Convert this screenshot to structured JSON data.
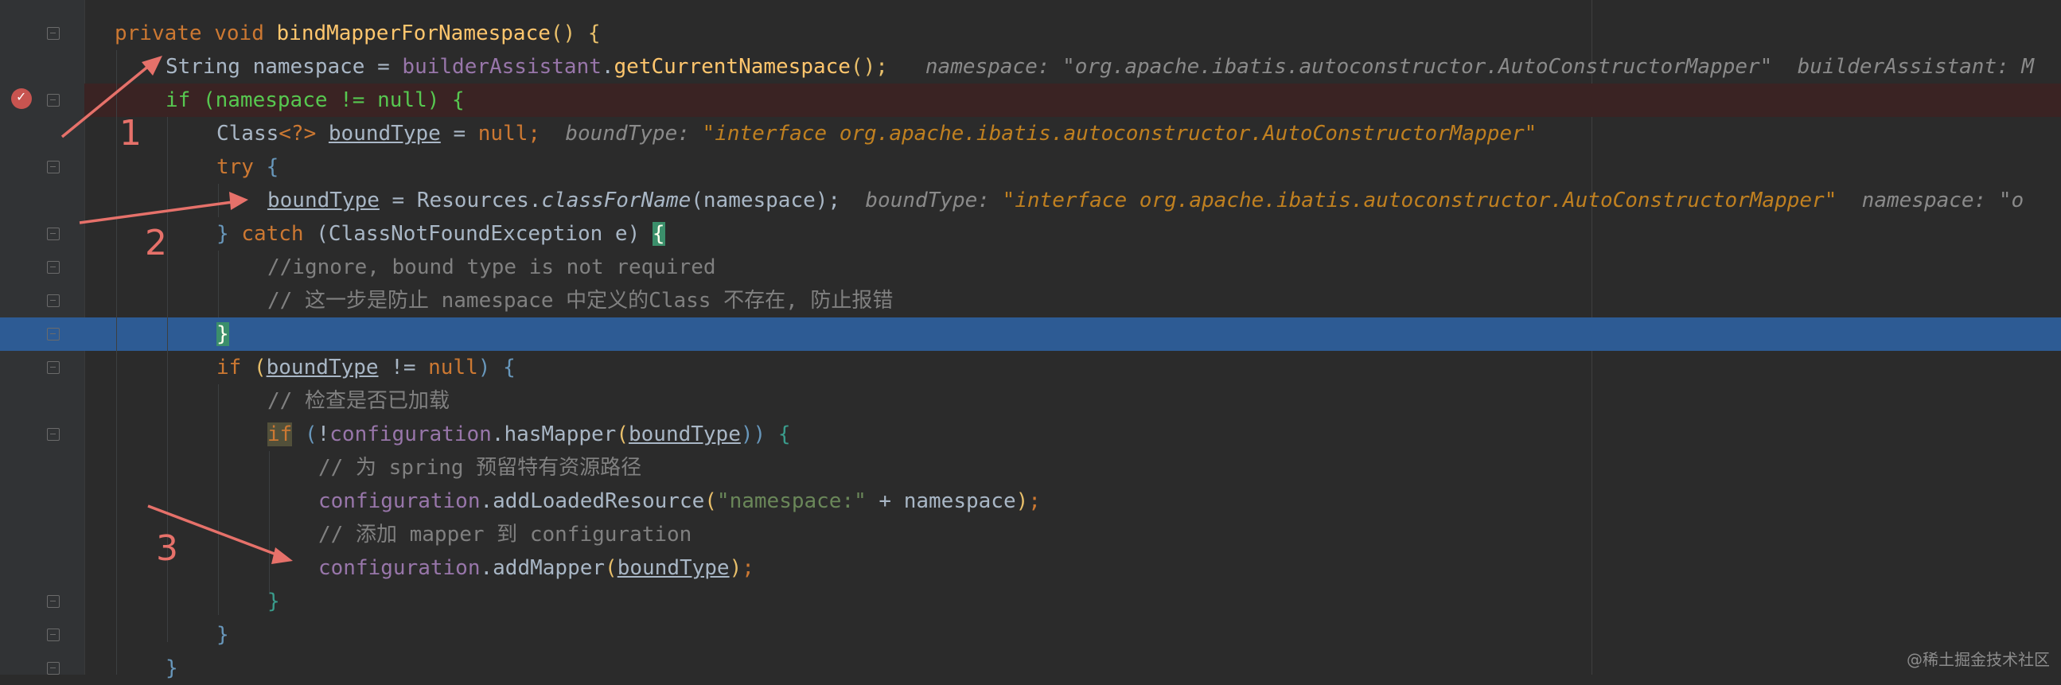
{
  "code": {
    "l1": {
      "a": "private ",
      "b": "void ",
      "c": "bindMapperForNamespace",
      "d": "() {"
    },
    "l2": {
      "a": "String namespace = ",
      "b": "builderAssistant",
      ".": ".",
      "c": "getCurrentNamespace",
      "d": "();",
      "h1": "namespace: ",
      "v1": "\"org.apache.ibatis.autoconstructor.AutoConstructorMapper\"",
      "h2": "builderAssistant: M"
    },
    "l3": {
      "a": "if ",
      "b": "(namespace != null) {"
    },
    "l4": {
      "a": "Class",
      "b": "<?>",
      "c": " ",
      "d": "boundType",
      "e": " = ",
      "f": "null",
      ";": ";",
      "h": "boundType: ",
      "v": "\"interface org.apache.ibatis.autoconstructor.AutoConstructorMapper\""
    },
    "l5": {
      "a": "try ",
      "b": "{"
    },
    "l6": {
      "a": "boundType",
      "b": " = Resources.",
      "c": "classForName",
      "d": "(namespace);",
      "h1": "boundType: ",
      "v1": "\"interface org.apache.ibatis.autoconstructor.AutoConstructorMapper\"",
      "h2": "namespace: \"o"
    },
    "l7": {
      "a": "} ",
      "b": "catch ",
      "c": "(ClassNotFoundException e) ",
      "d": "{"
    },
    "l8": "//ignore, bound type is not required",
    "l9": "// 这一步是防止 namespace 中定义的Class 不存在, 防止报错",
    "l10": "}",
    "l11": {
      "a": "if ",
      "b": "(",
      "c": "boundType",
      "d": " != ",
      "e": "null",
      "f": ") {"
    },
    "l12": "// 检查是否已加载",
    "l13": {
      "a": "if",
      "b": " (",
      "c": "!",
      "d": "configuration",
      ".": ".",
      "e": "hasMapper",
      "f": "(",
      "g": "boundType",
      "h": "))",
      "i": " {"
    },
    "l14": "// 为 spring 预留特有资源路径",
    "l15": {
      "a": "configuration",
      ".": ".",
      "b": "addLoadedResource",
      "c": "(",
      "d": "\"namespace:\"",
      "e": " + namespace",
      ")": ")",
      "f": ";"
    },
    "l16": "// 添加 mapper 到 configuration",
    "l17": {
      "a": "configuration",
      ".": ".",
      "b": "addMapper",
      "c": "(",
      "d": "boundType",
      ")": ")",
      "f": ";"
    },
    "l18": "}",
    "l19": "}",
    "l20": "}"
  },
  "annotations": {
    "n1": "1",
    "n2": "2",
    "n3": "3",
    "arrow_color": "#e6716a"
  },
  "watermark": "@稀土掘金技术社区",
  "colors": {
    "background": "#2b2b2b",
    "keyword": "#cc7832",
    "method": "#ffc66d",
    "field": "#9876aa",
    "string": "#6a8759",
    "comment": "#808080",
    "exec_line": "#2d5b94",
    "breakpoint": "#c75450"
  }
}
